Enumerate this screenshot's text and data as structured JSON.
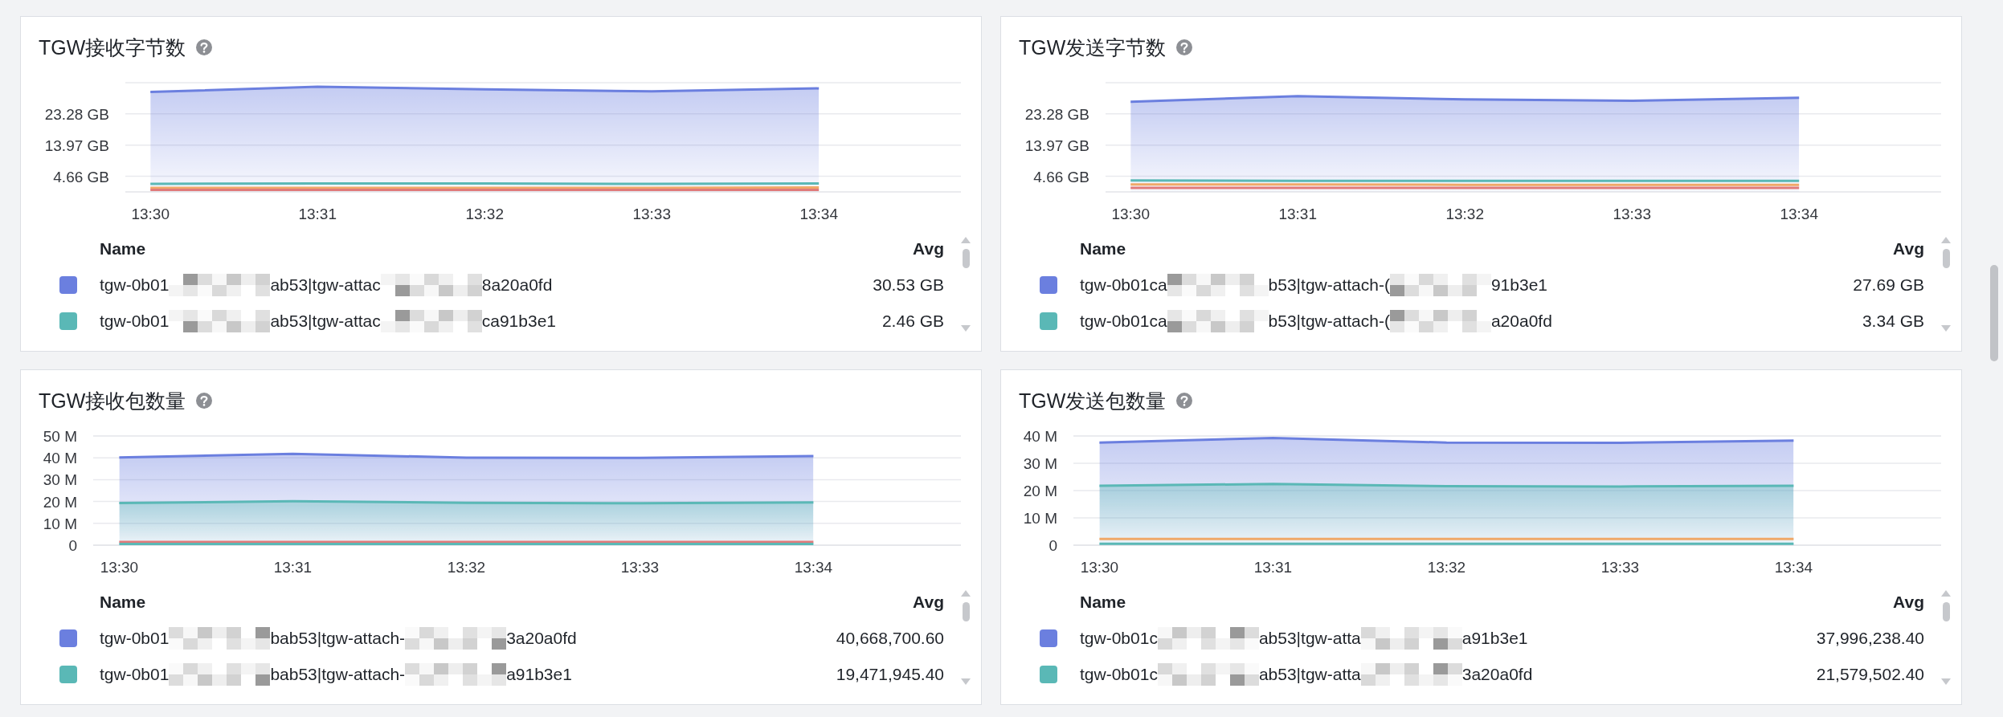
{
  "panels": [
    {
      "title": "TGW接收字节数",
      "chart_data": {
        "type": "area",
        "grid": true,
        "categories": [
          "13:30",
          "13:31",
          "13:32",
          "13:33",
          "13:34"
        ],
        "ylim": [
          0,
          32.59
        ],
        "yticks": [
          {
            "value": 4.66,
            "label": "4.66 GB"
          },
          {
            "value": 13.97,
            "label": "13.97 GB"
          },
          {
            "value": 23.28,
            "label": "23.28 GB"
          }
        ],
        "series": [
          {
            "type": "area",
            "color": "#6b7fdf",
            "values": [
              29.8,
              31.4,
              30.6,
              30.0,
              30.9
            ]
          },
          {
            "type": "line",
            "color": "#5ab8b6",
            "values": [
              2.4,
              2.5,
              2.5,
              2.4,
              2.5
            ]
          },
          {
            "type": "line",
            "color": "#f0a868",
            "values": [
              1.2,
              1.2,
              1.2,
              1.2,
              1.3
            ]
          },
          {
            "type": "line",
            "color": "#e07a7a",
            "values": [
              0.6,
              0.6,
              0.6,
              0.6,
              0.6
            ]
          }
        ]
      },
      "legend": {
        "columns": [
          "Name",
          "Avg"
        ],
        "rows": [
          {
            "color": "#6b7fdf",
            "name_parts": [
              "tgw-0b01",
              "ab53|tgw-attac",
              "8a20a0fd"
            ],
            "avg": "30.53 GB"
          },
          {
            "color": "#5ab8b6",
            "name_parts": [
              "tgw-0b01",
              "ab53|tgw-attac",
              "ca91b3e1"
            ],
            "avg": "2.46 GB"
          }
        ]
      }
    },
    {
      "title": "TGW发送字节数",
      "chart_data": {
        "type": "area",
        "grid": true,
        "categories": [
          "13:30",
          "13:31",
          "13:32",
          "13:33",
          "13:34"
        ],
        "ylim": [
          0,
          32.59
        ],
        "yticks": [
          {
            "value": 4.66,
            "label": "4.66 GB"
          },
          {
            "value": 13.97,
            "label": "13.97 GB"
          },
          {
            "value": 23.28,
            "label": "23.28 GB"
          }
        ],
        "series": [
          {
            "type": "area",
            "color": "#6b7fdf",
            "values": [
              26.9,
              28.6,
              27.6,
              27.2,
              28.1
            ]
          },
          {
            "type": "line",
            "color": "#5ab8b6",
            "values": [
              3.4,
              3.3,
              3.3,
              3.3,
              3.3
            ]
          },
          {
            "type": "line",
            "color": "#f0a868",
            "values": [
              2.2,
              2.2,
              2.1,
              2.1,
              2.1
            ]
          },
          {
            "type": "line",
            "color": "#e07a7a",
            "values": [
              1.2,
              1.2,
              1.2,
              1.2,
              1.2
            ]
          }
        ]
      },
      "legend": {
        "columns": [
          "Name",
          "Avg"
        ],
        "rows": [
          {
            "color": "#6b7fdf",
            "name_parts": [
              "tgw-0b01ca",
              "b53|tgw-attach-(",
              "91b3e1"
            ],
            "avg": "27.69 GB"
          },
          {
            "color": "#5ab8b6",
            "name_parts": [
              "tgw-0b01ca",
              "b53|tgw-attach-(",
              "a20a0fd"
            ],
            "avg": "3.34 GB"
          }
        ]
      }
    },
    {
      "title": "TGW接收包数量",
      "chart_data": {
        "type": "area",
        "grid": true,
        "categories": [
          "13:30",
          "13:31",
          "13:32",
          "13:33",
          "13:34"
        ],
        "ylim": [
          0,
          50
        ],
        "yticks": [
          {
            "value": 0,
            "label": "0"
          },
          {
            "value": 10,
            "label": "10 M"
          },
          {
            "value": 20,
            "label": "20 M"
          },
          {
            "value": 30,
            "label": "30 M"
          },
          {
            "value": 40,
            "label": "40 M"
          },
          {
            "value": 50,
            "label": "50 M"
          }
        ],
        "series": [
          {
            "type": "area",
            "color": "#6b7fdf",
            "values": [
              40.2,
              41.8,
              40.1,
              40.0,
              40.8
            ]
          },
          {
            "type": "area",
            "color": "#5ab8b6",
            "values": [
              19.3,
              20.1,
              19.4,
              19.2,
              19.6
            ]
          },
          {
            "type": "line",
            "color": "#e07a7a",
            "values": [
              1.5,
              1.5,
              1.5,
              1.5,
              1.5
            ]
          },
          {
            "type": "line",
            "color": "#5ab8b6",
            "values": [
              0.5,
              0.5,
              0.5,
              0.5,
              0.5
            ]
          }
        ]
      },
      "legend": {
        "columns": [
          "Name",
          "Avg"
        ],
        "rows": [
          {
            "color": "#6b7fdf",
            "name_parts": [
              "tgw-0b01",
              "bab53|tgw-attach-",
              "3a20a0fd"
            ],
            "avg": "40,668,700.60"
          },
          {
            "color": "#5ab8b6",
            "name_parts": [
              "tgw-0b01",
              "bab53|tgw-attach-",
              "a91b3e1"
            ],
            "avg": "19,471,945.40"
          }
        ]
      }
    },
    {
      "title": "TGW发送包数量",
      "chart_data": {
        "type": "area",
        "grid": true,
        "categories": [
          "13:30",
          "13:31",
          "13:32",
          "13:33",
          "13:34"
        ],
        "ylim": [
          0,
          40
        ],
        "yticks": [
          {
            "value": 0,
            "label": "0"
          },
          {
            "value": 10,
            "label": "10 M"
          },
          {
            "value": 20,
            "label": "20 M"
          },
          {
            "value": 30,
            "label": "30 M"
          },
          {
            "value": 40,
            "label": "40 M"
          }
        ],
        "series": [
          {
            "type": "area",
            "color": "#6b7fdf",
            "values": [
              37.6,
              39.3,
              37.6,
              37.5,
              38.3
            ]
          },
          {
            "type": "area",
            "color": "#5ab8b6",
            "values": [
              21.8,
              22.4,
              21.6,
              21.5,
              21.8
            ]
          },
          {
            "type": "line",
            "color": "#f0a868",
            "values": [
              2.3,
              2.3,
              2.3,
              2.3,
              2.3
            ]
          },
          {
            "type": "line",
            "color": "#5ab8b6",
            "values": [
              0.5,
              0.5,
              0.5,
              0.5,
              0.5
            ]
          }
        ]
      },
      "legend": {
        "columns": [
          "Name",
          "Avg"
        ],
        "rows": [
          {
            "color": "#6b7fdf",
            "name_parts": [
              "tgw-0b01c",
              "ab53|tgw-atta",
              "a91b3e1"
            ],
            "avg": "37,996,238.40"
          },
          {
            "color": "#5ab8b6",
            "name_parts": [
              "tgw-0b01c",
              "ab53|tgw-atta",
              "3a20a0fd"
            ],
            "avg": "21,579,502.40"
          }
        ]
      }
    }
  ]
}
